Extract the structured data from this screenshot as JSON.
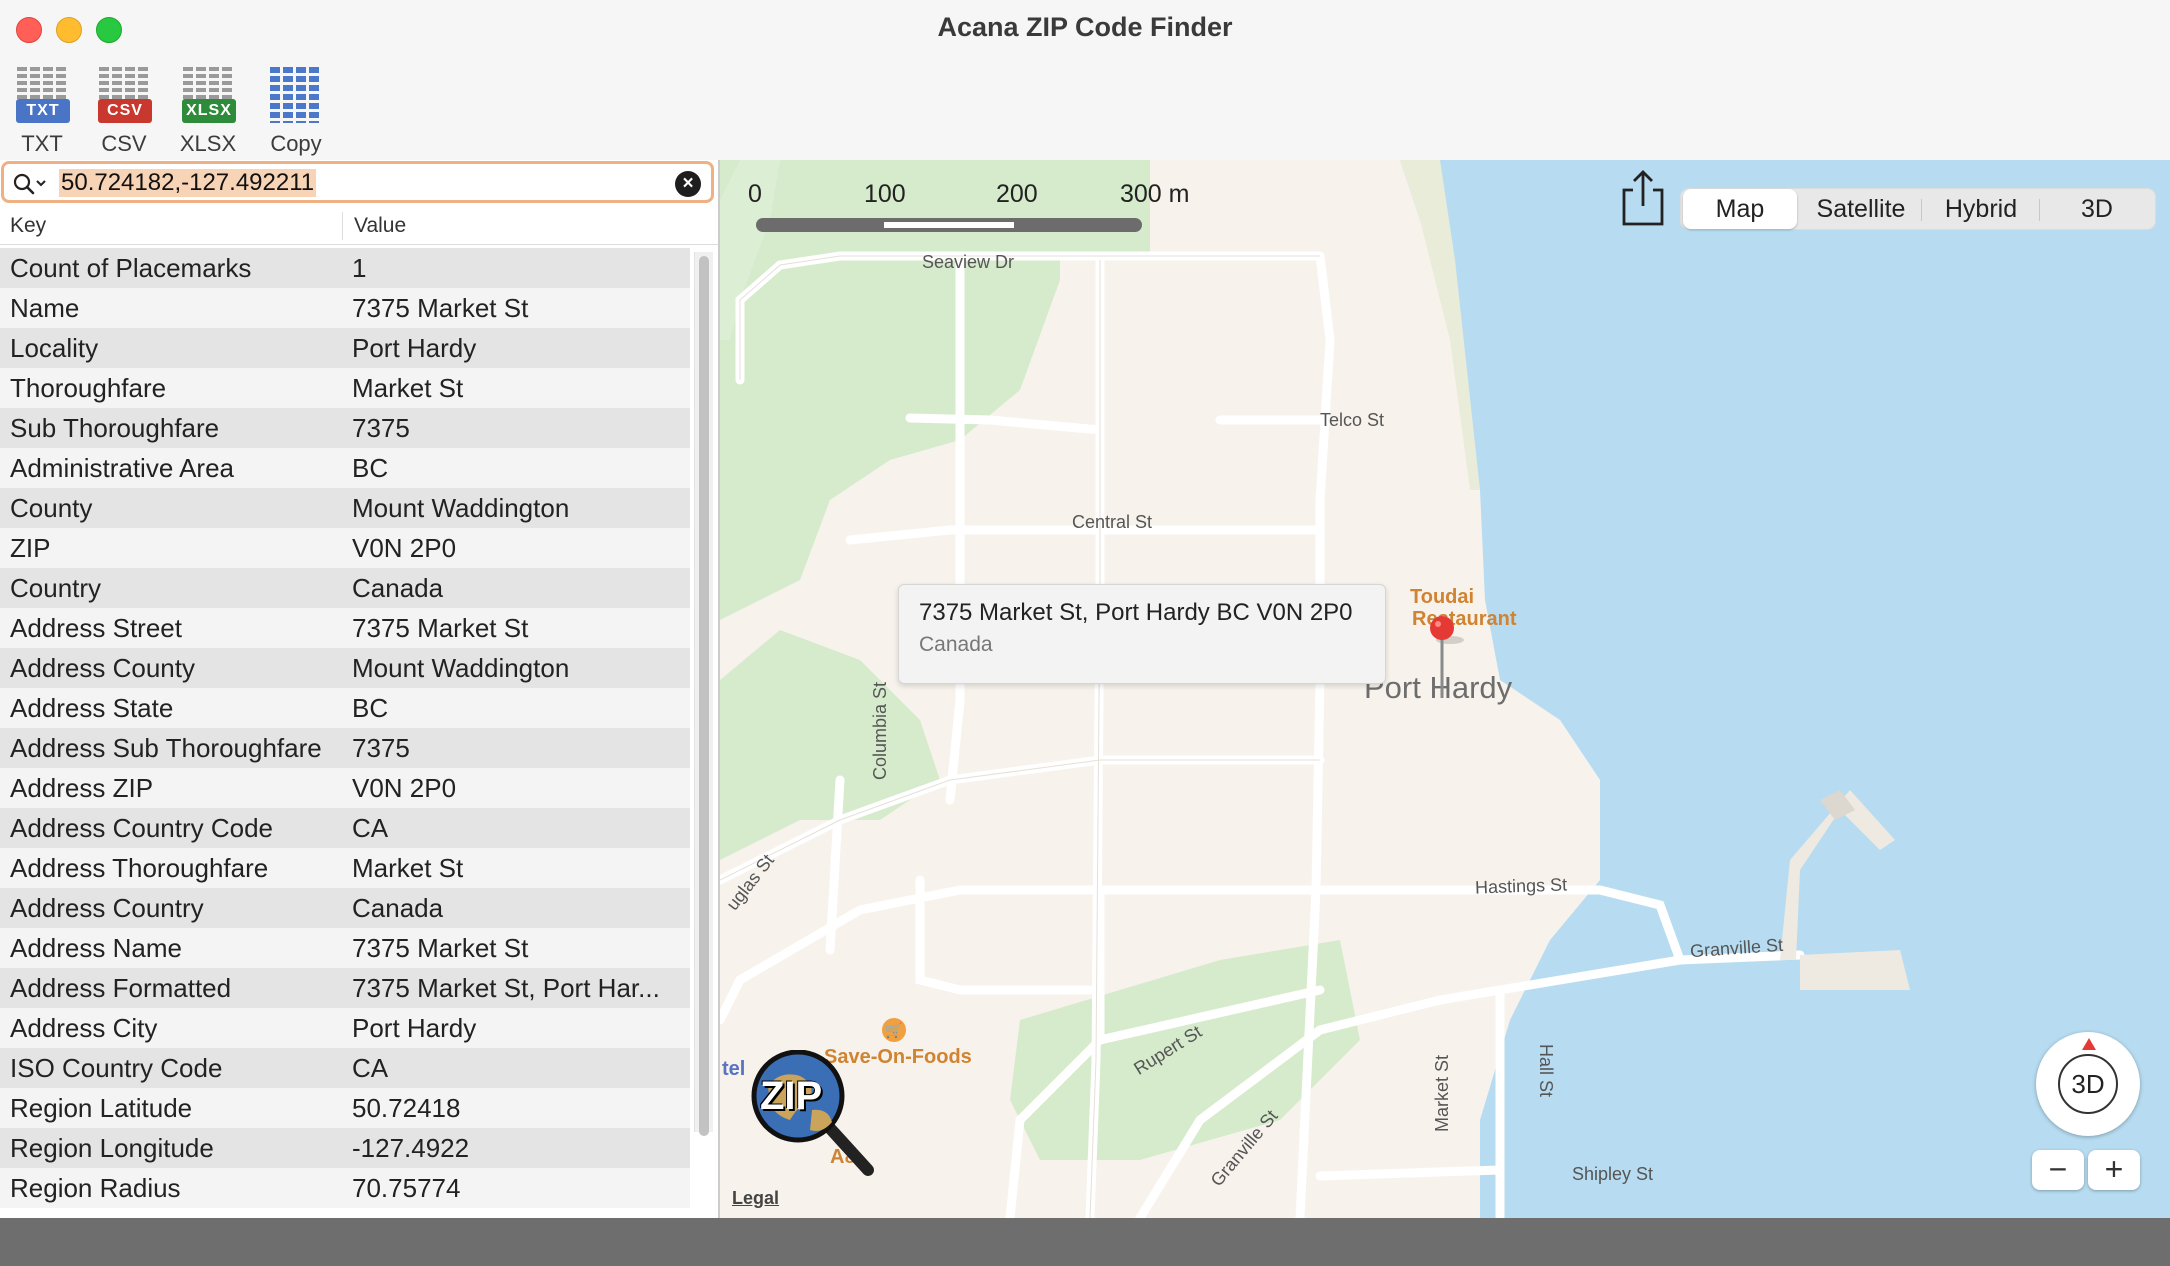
{
  "window": {
    "title": "Acana ZIP Code Finder"
  },
  "toolbar": {
    "buttons": [
      {
        "label": "TXT",
        "badge": "TXT",
        "color": "#4a74c6"
      },
      {
        "label": "CSV",
        "badge": "CSV",
        "color": "#c8382f"
      },
      {
        "label": "XLSX",
        "badge": "XLSX",
        "color": "#2e8b3a"
      },
      {
        "label": "Copy",
        "badge": "",
        "color": "#4b78c8"
      }
    ]
  },
  "search": {
    "value": "50.724182,-127.492211"
  },
  "table": {
    "columns": [
      "Key",
      "Value"
    ],
    "rows": [
      [
        "Count of Placemarks",
        "1"
      ],
      [
        "Name",
        "7375 Market St"
      ],
      [
        "Locality",
        "Port Hardy"
      ],
      [
        "Thoroughfare",
        "Market St"
      ],
      [
        "Sub Thoroughfare",
        "7375"
      ],
      [
        "Administrative Area",
        "BC"
      ],
      [
        "County",
        "Mount Waddington"
      ],
      [
        "ZIP",
        "V0N 2P0"
      ],
      [
        "Country",
        "Canada"
      ],
      [
        "Address Street",
        "7375 Market St"
      ],
      [
        "Address County",
        "Mount Waddington"
      ],
      [
        "Address State",
        "BC"
      ],
      [
        "Address Sub Thoroughfare",
        "7375"
      ],
      [
        "Address ZIP",
        "V0N 2P0"
      ],
      [
        "Address Country Code",
        "CA"
      ],
      [
        "Address Thoroughfare",
        "Market St"
      ],
      [
        "Address Country",
        "Canada"
      ],
      [
        "Address Name",
        "7375 Market St"
      ],
      [
        "Address Formatted",
        "7375 Market St, Port Har..."
      ],
      [
        "Address City",
        "Port Hardy"
      ],
      [
        "ISO Country Code",
        "CA"
      ],
      [
        "Region Latitude",
        "50.72418"
      ],
      [
        "Region Longitude",
        "-127.4922"
      ],
      [
        "Region Radius",
        "70.75774"
      ]
    ]
  },
  "map": {
    "scale": {
      "labels": [
        "0",
        "100",
        "200",
        "300 m"
      ]
    },
    "modes": [
      "Map",
      "Satellite",
      "Hybrid",
      "3D"
    ],
    "selected_mode": "Map",
    "streets": [
      "Seaview Dr",
      "Telco St",
      "Central St",
      "Columbia St",
      "Hastings St",
      "Granville St",
      "Rupert St",
      "Granville St",
      "Market St",
      "Hall St",
      "Shipley St",
      "uglas St"
    ],
    "pois": [
      "Toudai",
      "Restaurant",
      "Save-On-Foods",
      "A&",
      "tel"
    ],
    "callout": {
      "line1": "7375 Market St, Port Hardy BC V0N 2P0",
      "line2": "Canada"
    },
    "city_label": "Port Hardy",
    "legal": "Legal",
    "compass_label": "3D",
    "zoom_out": "−",
    "zoom_in": "+",
    "logo_text": "ZIP"
  },
  "colors": {
    "water": "#b7dcf1",
    "park": "#d5ebcc",
    "land": "#f7f3ec",
    "pin": "#e53935",
    "search_border": "#efb184"
  }
}
